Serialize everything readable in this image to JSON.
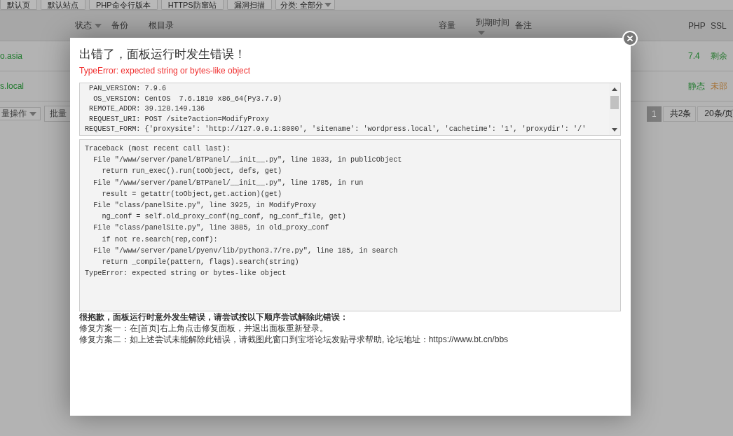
{
  "toolbar": {
    "buttons": [
      {
        "label": "默认页"
      },
      {
        "label": "默认站点"
      },
      {
        "label": "PHP命令行版本"
      },
      {
        "label": "HTTPS防窜站"
      },
      {
        "label": "漏洞扫描"
      }
    ],
    "category_select": "分类: 全部分"
  },
  "table": {
    "columns": [
      {
        "label": "状态",
        "kind": "sortable"
      },
      {
        "label": "备份",
        "kind": "plain"
      },
      {
        "label": "根目录",
        "kind": "plain"
      },
      {
        "label": "容量",
        "kind": "plain"
      },
      {
        "label": "到期时间",
        "kind": "stacked"
      },
      {
        "label": "备注",
        "kind": "plain"
      },
      {
        "label": "PHP",
        "kind": "plain"
      },
      {
        "label": "SSL",
        "kind": "plain"
      }
    ],
    "rows": [
      {
        "site": "o.asia",
        "php": "7.4",
        "ssl": {
          "text": "剩余",
          "color": "#2a7a32"
        }
      },
      {
        "site": "s.local",
        "php": "静态",
        "ssl": {
          "text": "未部",
          "color": "#a6743a"
        }
      }
    ]
  },
  "footer": {
    "batch_select": "量操作",
    "batch_button": "批量",
    "pagination": {
      "pages": [
        {
          "label": "1",
          "selected": true
        }
      ],
      "total": "共2条",
      "per_page": "20条/页"
    }
  },
  "dialog": {
    "title": "出错了，面板运行时发生错误！",
    "error": "TypeError: expected string or bytes-like object",
    "info_lines": [
      " PAN_VERSION: 7.9.6",
      "  OS_VERSION: CentOS  7.6.1810 x86_64(Py3.7.9)",
      " REMOTE_ADDR: 39.128.149.136",
      " REQUEST_URI: POST /site?action=ModifyProxy",
      "REQUEST_FORM: {'proxysite': 'http://127.0.0.1:8000', 'sitename': 'wordpress.local', 'cachetime': '1', 'proxydir': '/'"
    ],
    "traceback_lines": [
      "Traceback (most recent call last):",
      "  File \"/www/server/panel/BTPanel/__init__.py\", line 1833, in publicObject",
      "    return run_exec().run(toObject, defs, get)",
      "  File \"/www/server/panel/BTPanel/__init__.py\", line 1785, in run",
      "    result = getattr(toObject,get.action)(get)",
      "  File \"class/panelSite.py\", line 3925, in ModifyProxy",
      "    ng_conf = self.old_proxy_conf(ng_conf, ng_conf_file, get)",
      "  File \"class/panelSite.py\", line 3885, in old_proxy_conf",
      "    if not re.search(rep,conf):",
      "  File \"/www/server/panel/pyenv/lib/python3.7/re.py\", line 185, in search",
      "    return _compile(pattern, flags).search(string)",
      "TypeError: expected string or bytes-like object"
    ],
    "help_heading": "很抱歉，面板运行时意外发生错误，请尝试按以下顺序尝试解除此错误：",
    "help_lines": [
      "修复方案一：在[首页]右上角点击修复面板，并退出面板重新登录。",
      "修复方案二：如上述尝试未能解除此错误，请截图此窗口到宝塔论坛发贴寻求帮助, 论坛地址：https://www.bt.cn/bbs"
    ]
  }
}
